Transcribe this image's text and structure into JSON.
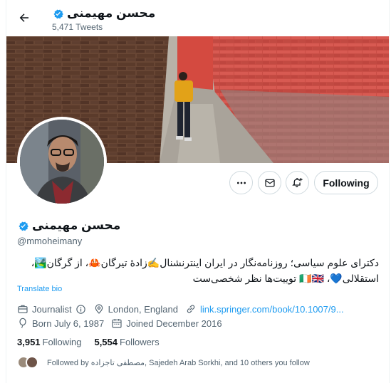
{
  "header": {
    "back_icon": "arrow-left-icon",
    "name": "محسن مهیمنی",
    "tweets_count": "5,471 Tweets"
  },
  "profile": {
    "name": "محسن مهیمنی",
    "handle": "@mmoheimany",
    "verified": true,
    "bio": "دکترای علوم سیاسی؛ روزنامه‌نگار در ایران اینترنشنال✍️زادهٔ تیرگان🦀، از گرگان🏞️، استقلالی💙، 🇮🇪🇬🇧 توییت‌ها نظر شخصی‌ست",
    "translate_label": "Translate bio",
    "category": "Journalist",
    "location": "London, England",
    "website": "link.springer.com/book/10.1007/9...",
    "born": "Born July 6, 1987",
    "joined": "Joined December 2016",
    "following_count": "3,951",
    "following_label": "Following",
    "followers_count": "5,554",
    "followers_label": "Followers",
    "followed_by": "Followed by مصطفی تاجزاده, Sajedeh Arab Sorkhi, and 10 others you follow"
  },
  "actions": {
    "more_icon": "more-dots-icon",
    "message_icon": "mail-icon",
    "notify_icon": "bell-plus-icon",
    "following_label": "Following"
  },
  "colors": {
    "accent": "#1d9bf0",
    "text": "#0f1419",
    "secondary": "#536471",
    "border": "#cfd9de"
  }
}
